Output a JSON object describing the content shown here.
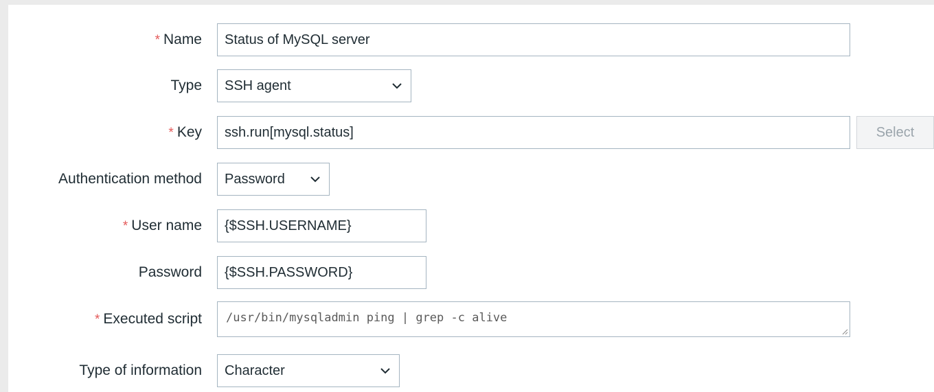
{
  "form": {
    "name": {
      "label": "Name",
      "required": true,
      "value": "Status of MySQL server"
    },
    "type": {
      "label": "Type",
      "required": false,
      "value": "SSH agent"
    },
    "key": {
      "label": "Key",
      "required": true,
      "value": "ssh.run[mysql.status]",
      "select_button": "Select"
    },
    "auth_method": {
      "label": "Authentication method",
      "required": false,
      "value": "Password"
    },
    "user_name": {
      "label": "User name",
      "required": true,
      "value": "{$SSH.USERNAME}"
    },
    "password": {
      "label": "Password",
      "required": false,
      "value": "{$SSH.PASSWORD}"
    },
    "executed_script": {
      "label": "Executed script",
      "required": true,
      "value": "/usr/bin/mysqladmin ping | grep -c alive"
    },
    "type_of_information": {
      "label": "Type of information",
      "required": false,
      "value": "Character"
    }
  },
  "required_marker": "*",
  "icons": {
    "dropdown": "chevron-down-icon",
    "resize": "resize-handle-icon"
  },
  "colors": {
    "required": "#e45959",
    "border": "#a4b4c0",
    "text": "#1f2c33",
    "background": "#ffffff"
  }
}
